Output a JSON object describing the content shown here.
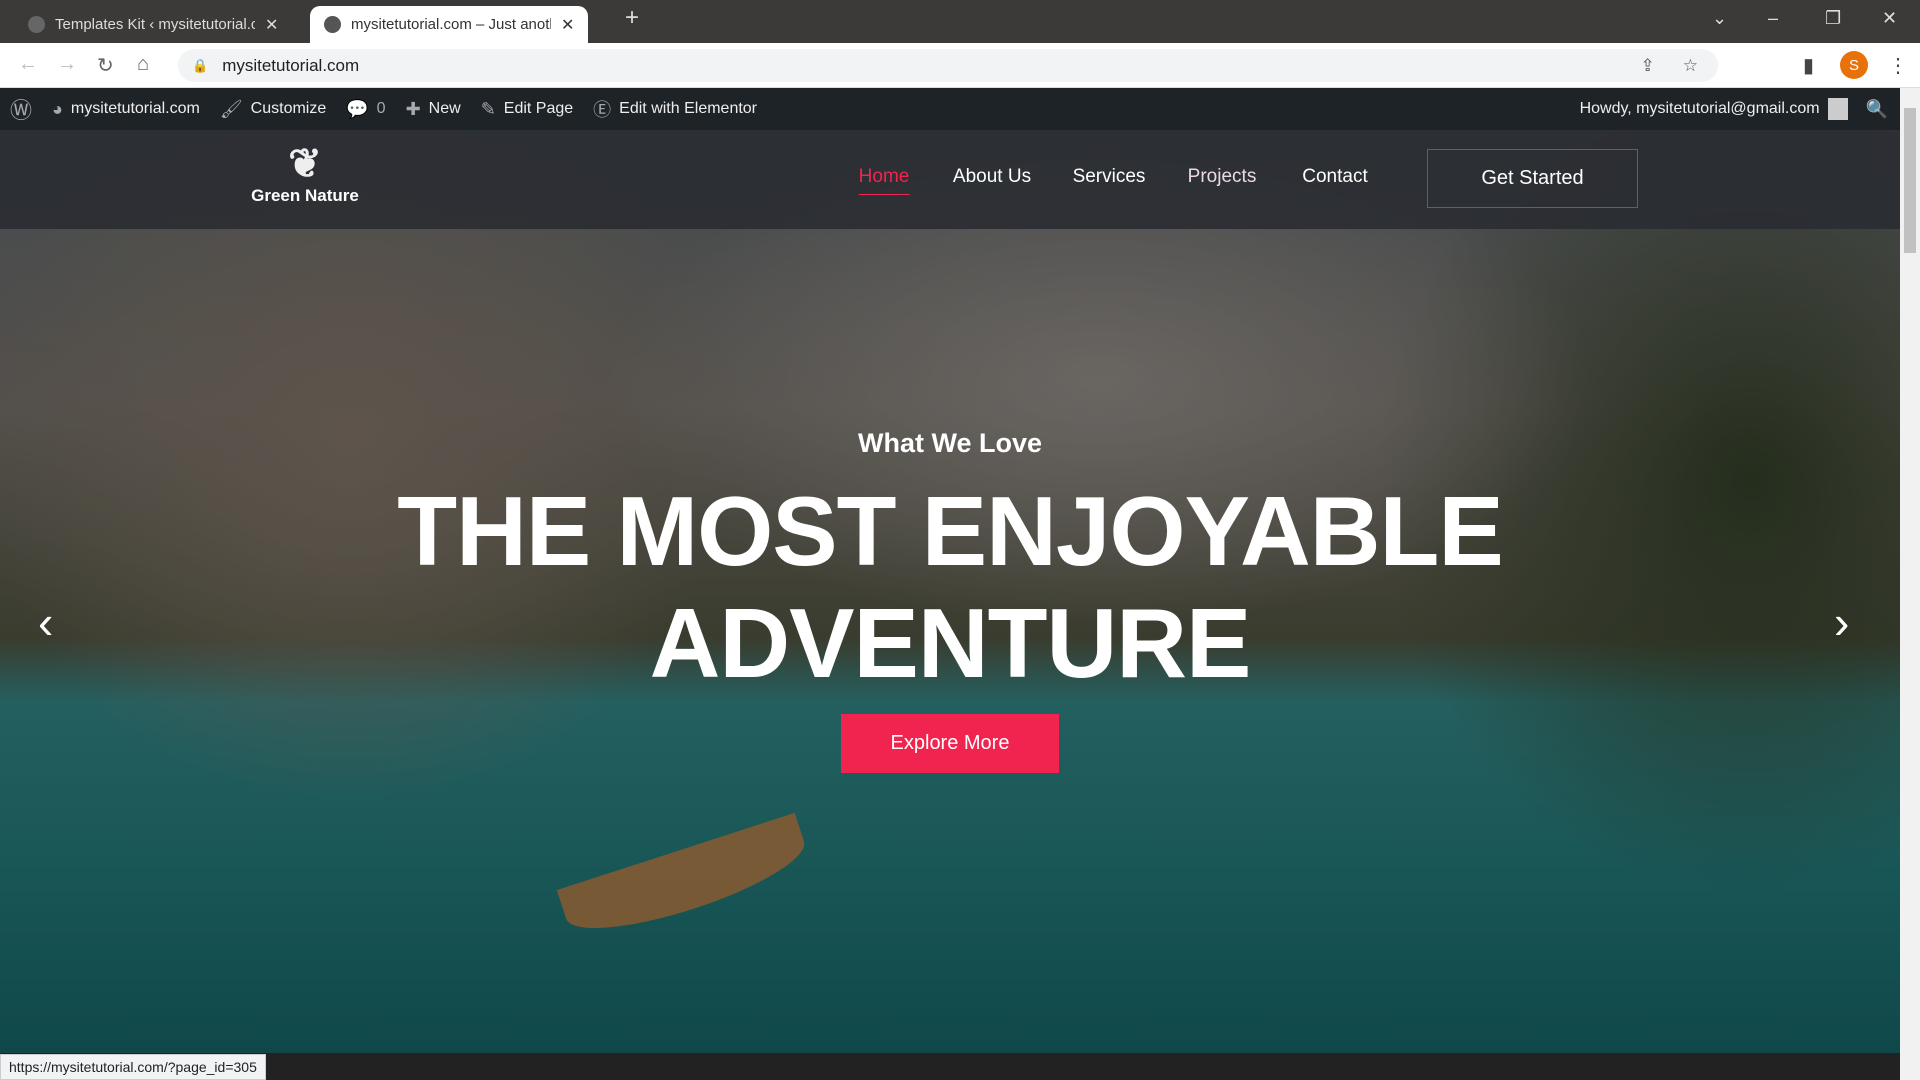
{
  "browser": {
    "tabs": [
      {
        "title": "Templates Kit ‹ mysitetutorial.com",
        "active": false
      },
      {
        "title": "mysitetutorial.com – Just another",
        "active": true
      }
    ],
    "url": "mysitetutorial.com",
    "profile_initial": "S",
    "status_url": "https://mysitetutorial.com/?page_id=305"
  },
  "admin_bar": {
    "site": "mysitetutorial.com",
    "customize": "Customize",
    "comments": "0",
    "new": "New",
    "edit_page": "Edit Page",
    "elementor": "Edit with Elementor",
    "howdy": "Howdy, mysitetutorial@gmail.com"
  },
  "site": {
    "logo": "Green Nature",
    "menu": [
      "Home",
      "About Us",
      "Services",
      "Projects",
      "Contact"
    ],
    "active_menu": "Home",
    "cta": "Get Started"
  },
  "hero": {
    "kicker": "What We Love",
    "line1": "THE MOST ENJOYABLE",
    "line2": "ADVENTURE",
    "button": "Explore More"
  },
  "colors": {
    "accent": "#f0244f",
    "adminbar": "#1d2327",
    "profile": "#e8710a"
  }
}
